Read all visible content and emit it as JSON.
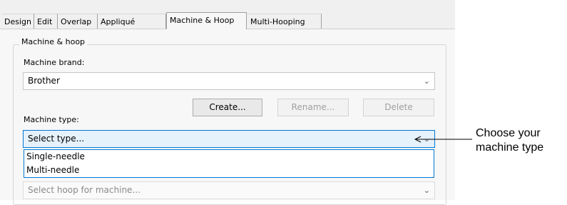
{
  "tabs": [
    {
      "label": "Design",
      "active": false
    },
    {
      "label": "Edit",
      "active": false
    },
    {
      "label": "Overlap",
      "active": false
    },
    {
      "label": "Appliqué",
      "active": false
    },
    {
      "label": "Machine & Hoop",
      "active": true
    },
    {
      "label": "Multi-Hooping",
      "active": false
    }
  ],
  "group": {
    "title": "Machine & hoop"
  },
  "brand": {
    "label": "Machine brand:",
    "value": "Brother"
  },
  "buttons": {
    "create": "Create...",
    "rename": "Rename...",
    "delete": "Delete"
  },
  "type": {
    "label": "Machine type:",
    "value": "Select type...",
    "options": [
      "Single-needle",
      "Multi-needle"
    ]
  },
  "hoop": {
    "value": "Select hoop for machine..."
  },
  "callout": {
    "line1": "Choose your",
    "line2": "machine type"
  },
  "colors": {
    "focus": "#0078d7",
    "panel": "#f7f7f7"
  }
}
